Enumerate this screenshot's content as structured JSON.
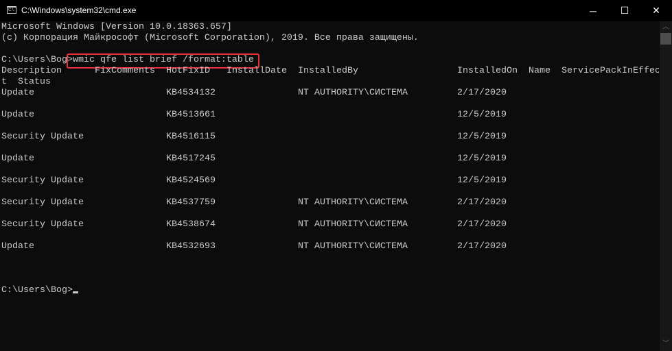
{
  "window": {
    "title": "C:\\Windows\\system32\\cmd.exe",
    "icon": "cmd-icon",
    "icon_text": "C:\\.",
    "minimize": "─",
    "maximize": "☐",
    "close": "✕"
  },
  "console": {
    "banner1": "Microsoft Windows [Version 10.0.18363.657]",
    "banner2": "(c) Корпорация Майкрософт (Microsoft Corporation), 2019. Все права защищены.",
    "prompt": "C:\\Users\\Bog>",
    "command": "wmic qfe list brief /format:table",
    "headers": [
      "Description",
      "FixComments",
      "HotFixID",
      "InstallDate",
      "InstalledBy",
      "InstalledOn",
      "Name",
      "ServicePackInEffec"
    ],
    "header_wrap": "t  Status",
    "rows": [
      {
        "description": "Update",
        "hotfixid": "KB4534132",
        "installedby": "NT AUTHORITY\\СИСТЕМА",
        "installedon": "2/17/2020"
      },
      {
        "description": "Update",
        "hotfixid": "KB4513661",
        "installedby": "",
        "installedon": "12/5/2019"
      },
      {
        "description": "Security Update",
        "hotfixid": "KB4516115",
        "installedby": "",
        "installedon": "12/5/2019"
      },
      {
        "description": "Update",
        "hotfixid": "KB4517245",
        "installedby": "",
        "installedon": "12/5/2019"
      },
      {
        "description": "Security Update",
        "hotfixid": "KB4524569",
        "installedby": "",
        "installedon": "12/5/2019"
      },
      {
        "description": "Security Update",
        "hotfixid": "KB4537759",
        "installedby": "NT AUTHORITY\\СИСТЕМА",
        "installedon": "2/17/2020"
      },
      {
        "description": "Security Update",
        "hotfixid": "KB4538674",
        "installedby": "NT AUTHORITY\\СИСТЕМА",
        "installedon": "2/17/2020"
      },
      {
        "description": "Update",
        "hotfixid": "KB4532693",
        "installedby": "NT AUTHORITY\\СИСТЕМА",
        "installedon": "2/17/2020"
      }
    ],
    "final_prompt": "C:\\Users\\Bog>"
  },
  "colors": {
    "background": "#0c0c0c",
    "text": "#cccccc",
    "highlight": "#e8313a"
  }
}
